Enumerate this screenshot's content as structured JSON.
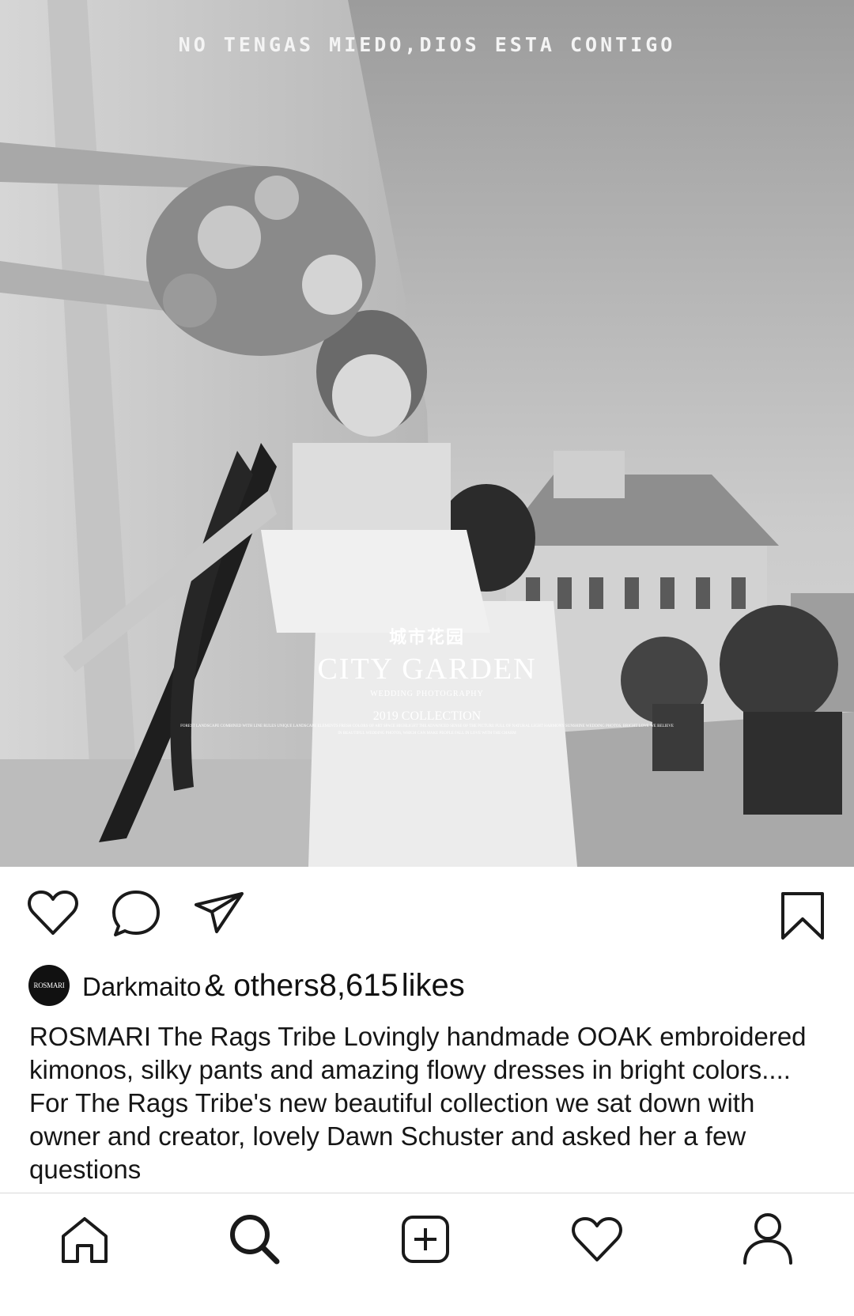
{
  "post": {
    "headline": "NO TENGAS MIEDO,DIOS ESTA CONTIGO",
    "brand": {
      "chinese_name": "城市花园",
      "name": "CITY GARDEN",
      "subtitle": "WEDDING PHOTOGRAPHY",
      "collection": "2019 COLLECTION",
      "fine_print": "FOREST LANDSCAPE COMBINED WITH LINE RULES UNIQUE LANDSCAPE ELEMENTS FRESH COLORS OF ART SPACE HIGHLIGHT THE ADVANCED SENSE OF THE PICTURE FULL OF NATURAL LIGHT HARMONY SUNSHINE WEDDING PHOTOS, BRIGHT LOVE WE BELIEVE IN BEAUTIFUL WEDDING PHOTOS, WHICH CAN MAKE PEOPLE FALL IN LOVE WITH THE CHARM"
    },
    "actions": {
      "like": "heart-icon",
      "comment": "comment-icon",
      "share": "send-icon",
      "save": "bookmark-icon"
    },
    "likes": {
      "avatar_text": "ROSMARI",
      "username": "Darkmaito",
      "connector": "& others",
      "count": "8,615",
      "suffix": "likes"
    },
    "caption": {
      "username": "ROSMARI",
      "text": "The Rags Tribe Lovingly handmade OOAK embroidered kimonos, silky pants and amazing flowy dresses in bright colors.... For The Rags Tribe's new beautiful collection we sat down with owner and creator, lovely Dawn Schuster and asked her a few questions"
    }
  },
  "tabbar": [
    "home-icon",
    "search-icon",
    "add-post-icon",
    "activity-icon",
    "profile-icon"
  ],
  "colors": {
    "icon": "#1a1a1a",
    "text": "#161616",
    "background": "#ffffff"
  }
}
